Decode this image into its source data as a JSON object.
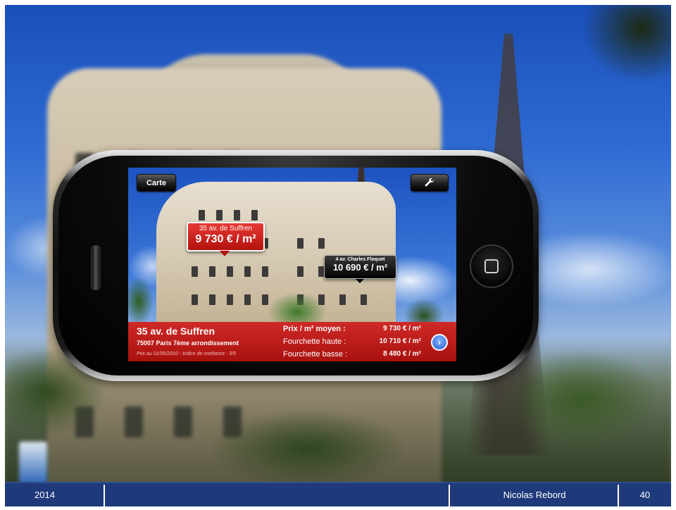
{
  "footer": {
    "year": "2014",
    "author": "Nicolas Rebord",
    "page": "40"
  },
  "app": {
    "buttons": {
      "map": "Carte",
      "settings_icon": "wrench-icon"
    },
    "tags": [
      {
        "address": "35 av. de Suffren",
        "price": "9 730 € / m²",
        "style": "selected"
      },
      {
        "address": "4 av. Charles Floquet",
        "price": "10 690 € / m²",
        "style": "default"
      }
    ],
    "info": {
      "address": "35 av. de Suffren",
      "city": "75007 Paris 7ème arrondissement",
      "date_note": "Prix au 01/05/2010 - Indice de confiance : 3/5",
      "rows": [
        {
          "label": "Prix / m² moyen :",
          "value": "9 730 € / m²"
        },
        {
          "label": "Fourchette haute :",
          "value": "10 710 € / m²"
        },
        {
          "label": "Fourchette basse :",
          "value": "8 480 € / m²"
        }
      ]
    }
  },
  "colors": {
    "footer_bg": "#1f3a7a",
    "tag_red": "#cf2a27",
    "info_bar": "#b81b18"
  }
}
